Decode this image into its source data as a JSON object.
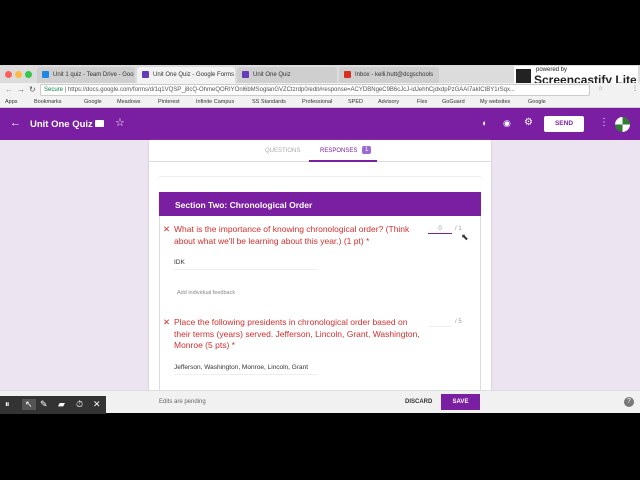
{
  "browser": {
    "tabs": [
      {
        "label": "Unit 1 quiz - Team Drive - Goo",
        "color": "#1e88e5"
      },
      {
        "label": "Unit One Quiz - Google Forms",
        "color": "#673ab7"
      },
      {
        "label": "Unit One Quiz",
        "color": "#673ab7"
      },
      {
        "label": "Inbox - kelli.hutt@dcgschools",
        "color": "#d93025"
      }
    ],
    "secure": "Secure",
    "url": "https://docs.google.com/forms/d/1q1VQSP_j8cQ-OhmeQORIYOnl6bMSoglanGVZCtzrdp0/edit#response=ACYDBNgeC9B6cJcJ-idJehhCjdxdpPzGAAI7akICtBY1rSqx...",
    "bookmarks": [
      "Apps",
      "Bookmarks",
      "Google",
      "Meadows",
      "Pinterest",
      "Infinite Campus",
      "SS Standards",
      "Professional",
      "SPED",
      "Advisory",
      "Flex",
      "GoGuard",
      "My websites",
      "Google"
    ]
  },
  "screencastify": {
    "powered": "powered by",
    "name": "Screencastify Lite"
  },
  "header": {
    "title": "Unit One Quiz",
    "send": "SEND"
  },
  "form_tabs": {
    "questions": "QUESTIONS",
    "responses": "RESPONSES",
    "count": "1"
  },
  "section": {
    "title": "Section Two: Chronological Order"
  },
  "questions": [
    {
      "text": "What is the importance of knowing chronological order? (Think about what we'll be learning about this year.) (1 pt) *",
      "score": "0",
      "max": "/ 1",
      "answer": "IDK",
      "feedback": "Add individual feedback"
    },
    {
      "text": "Place the following presidents in chronological order based on their terms (years) served. Jefferson, Lincoln, Grant, Washington, Monroe (5 pts) *",
      "score": "",
      "max": "/ 5",
      "answer": "Jefferson, Washington, Monroe, Lincoln, Grant"
    }
  ],
  "footer": {
    "status": "Edits are pending",
    "discard": "DISCARD",
    "save": "SAVE"
  },
  "colors": {
    "accent": "#7b1fa2",
    "error": "#d32f2f"
  }
}
